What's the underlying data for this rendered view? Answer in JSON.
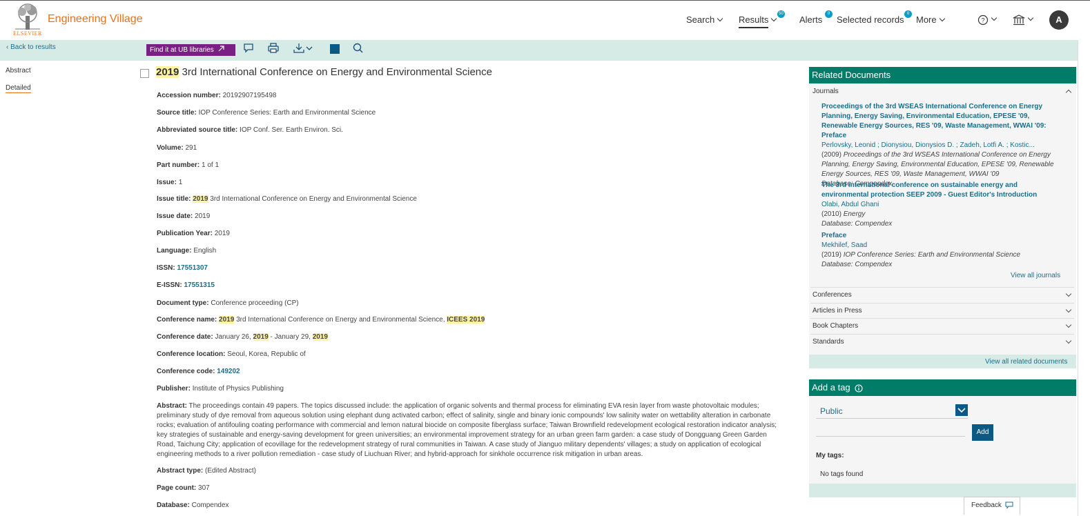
{
  "header": {
    "brand": "Engineering Village",
    "logo_text": "ELSEVIER",
    "nav": {
      "search": "Search",
      "results": "Results",
      "results_badge": "50",
      "alerts": "Alerts",
      "alerts_badge": "0",
      "selected": "Selected records",
      "selected_badge": "0",
      "more": "More"
    },
    "avatar": "A"
  },
  "toolbar": {
    "back": "‹ Back to results",
    "find": "Find it at UB libraries"
  },
  "leftnav": {
    "abstract": "Abstract",
    "detailed": "Detailed"
  },
  "record": {
    "title_year": "2019",
    "title_rest": " 3rd International Conference on Energy and Environmental Science",
    "fields": {
      "accession_label": "Accession number:",
      "accession": "20192907195498",
      "source_label": "Source title:",
      "source": "IOP Conference Series: Earth and Environmental Science",
      "abbrev_label": "Abbreviated source title:",
      "abbrev": "IOP Conf. Ser. Earth Environ. Sci.",
      "volume_label": "Volume:",
      "volume": "291",
      "part_label": "Part number:",
      "part": "1 of 1",
      "issue_label": "Issue:",
      "issue": "1",
      "issue_title_label": "Issue title:",
      "issue_title_year": "2019",
      "issue_title_rest": "3rd International Conference on Energy and Environmental Science",
      "issue_date_label": "Issue date:",
      "issue_date": "2019",
      "pub_year_label": "Publication Year:",
      "pub_year": "2019",
      "language_label": "Language:",
      "language": "English",
      "issn_label": "ISSN:",
      "issn": "17551307",
      "eissn_label": "E-ISSN:",
      "eissn": "17551315",
      "doctype_label": "Document type:",
      "doctype": "Conference proceeding (CP)",
      "confname_label": "Conference name:",
      "confname_year": "2019",
      "confname_rest": "3rd International Conference on Energy and Environmental Science,",
      "confname_acr": "ICEES 2019",
      "confdate_label": "Conference date:",
      "confdate_a": "January 26,",
      "confdate_y1": "2019",
      "confdate_b": "- January 29,",
      "confdate_y2": "2019",
      "confloc_label": "Conference location:",
      "confloc": "Seoul, Korea, Republic of",
      "confcode_label": "Conference code:",
      "confcode": "149202",
      "publisher_label": "Publisher:",
      "publisher": "Institute of Physics Publishing",
      "abstract_label": "Abstract:",
      "abstract": "The proceedings contain 49 papers. The topics discussed include: the application of organic solvents and thermal process for eliminating EVA resin layer from waste photovoltaic modules; preliminary study of dye removal from aqueous solution using elephant dung activated carbon; effect of salinity, single and binary ionic compounds' low salinity water on wettability alteration in carbonate rocks; evaluation of antifouling coating performance with commercial and lemon natural biocide on composite fiberglass surface; Taiwan Brownfield redevelopment ecological restoration indicator analysis; key strategies of sustainable and energy-saving development for green universities; an environmental improvement strategy for an urban green farm garden: a case study of Dongguang Green Garden Road, Taichung City; application of ecovillage for the redevelopment strategy of rural communities in Taiwan. A case study of Jianguo military dependents' villages; a study on application of ecological engineering methods to a river pollution remediation - case study of Liuchuan River; and hybrid-approach for sinkhole occurrence risk mitigation in urban areas.",
      "abstract_type_label": "Abstract type:",
      "abstract_type": "(Edited Abstract)",
      "page_count_label": "Page count:",
      "page_count": "307",
      "database_label": "Database:",
      "database": "Compendex"
    }
  },
  "related": {
    "heading": "Related Documents",
    "journals": "Journals",
    "items": [
      {
        "title": "Proceedings of the 3rd WSEAS International Conference on Energy Planning, Energy Saving, Environmental Education, EPESE '09, Renewable Energy Sources, RES '09, Waste Management, WWAI '09: Preface",
        "authors": "Perlovsky, Leonid ; Dionysiou, Dionysios D. ; Zadeh, Lotfi A. ; Kostic...",
        "year": "(2009)",
        "source": "Proceedings of the 3rd WSEAS International Conference on Energy Planning, Energy Saving, Environmental Education, EPESE '09, Renewable Energy Sources, RES '09, Waste Management, WWAI '09",
        "db": "Database: Compendex"
      },
      {
        "title": "The 3rd international conference on sustainable energy and environmental protection SEEP 2009 - Guest Editor's Introduction",
        "authors": "Olabi, Abdul Ghani",
        "year": "(2010)",
        "source": "Energy",
        "db": "Database: Compendex"
      },
      {
        "title": "Preface",
        "authors": "Mekhilef, Saad",
        "year": "(2019)",
        "source": "IOP Conference Series: Earth and Environmental Science",
        "db": "Database: Compendex"
      }
    ],
    "view_all_journals": "View all journals",
    "conferences": "Conferences",
    "articles": "Articles in Press",
    "book_chapters": "Book Chapters",
    "standards": "Standards",
    "view_all_related": "View all related documents"
  },
  "tags": {
    "heading": "Add a tag",
    "select_value": "Public",
    "add": "Add",
    "my_tags": "My tags:",
    "no_tags": "No tags found"
  },
  "feedback": "Feedback",
  "colors": {
    "brand_orange": "#e9711c",
    "panel_green": "#007c68",
    "toolbar_bg": "#d7ebe6",
    "find_purple": "#7a1f84",
    "link_blue": "#1c6d8a",
    "highlight": "#fff3a3"
  }
}
